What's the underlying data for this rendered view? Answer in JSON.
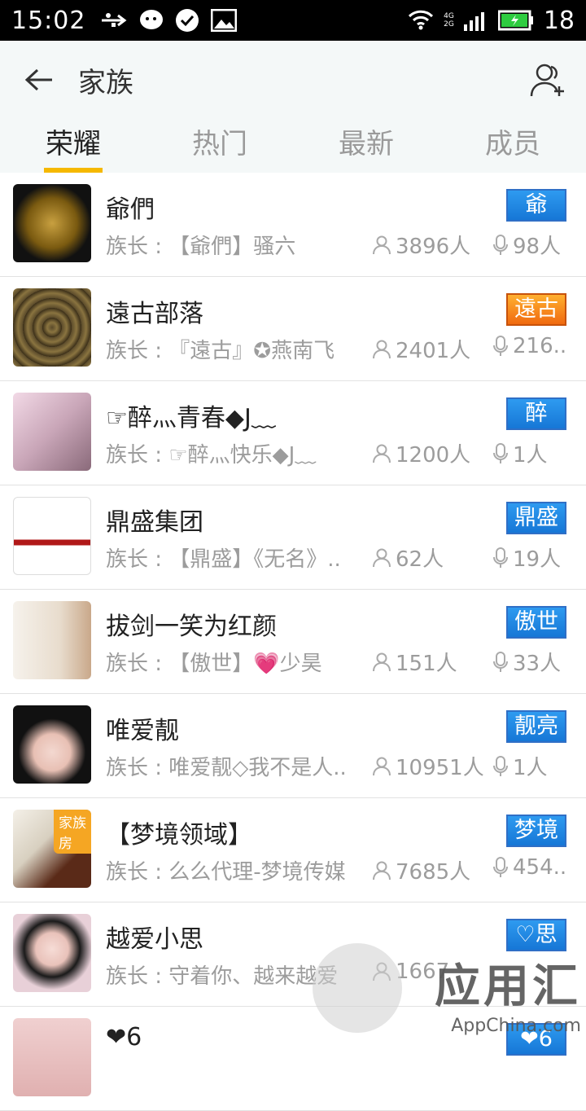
{
  "status_bar": {
    "time": "15:02",
    "battery_level": "18",
    "icons": [
      "usb-icon",
      "wechat-icon",
      "check-circle-icon",
      "image-icon",
      "wifi-icon",
      "signal-4g-icon",
      "battery-icon"
    ],
    "network_4g": "4G",
    "network_2g": "2G"
  },
  "header": {
    "title": "家族",
    "back_icon": "arrow-left-icon",
    "add_icon": "add-member-icon"
  },
  "tabs": [
    {
      "label": "荣耀",
      "active": true
    },
    {
      "label": "热门",
      "active": false
    },
    {
      "label": "最新",
      "active": false
    },
    {
      "label": "成员",
      "active": false
    }
  ],
  "families": [
    {
      "name": "爺們",
      "leader": "族长 : 【爺們】骚六",
      "members": "3896人",
      "voice": "98人",
      "badge": "爺",
      "badge_style": "blue"
    },
    {
      "name": "遠古部落",
      "leader": "族长 : 『遠古』✪燕南飞",
      "members": "2401人",
      "voice": "216..",
      "badge": "遠古",
      "badge_style": "orange"
    },
    {
      "name": "☞醉灬青春◆J﹏",
      "leader": "族长 : ☞醉灬快乐◆J﹏",
      "members": "1200人",
      "voice": "1人",
      "badge": "醉",
      "badge_style": "blue"
    },
    {
      "name": "鼎盛集团",
      "leader": "族长 : 【鼎盛】《无名》..",
      "members": "62人",
      "voice": "19人",
      "badge": "鼎盛",
      "badge_style": "blue"
    },
    {
      "name": "拔剑一笑为红颜",
      "leader": "族长 : 【傲世】💗少昊",
      "members": "151人",
      "voice": "33人",
      "badge": "傲世",
      "badge_style": "blue"
    },
    {
      "name": "唯爱靓",
      "leader": "族长 : 唯爱靓◇我不是人..",
      "members": "10951人",
      "voice": "1人",
      "badge": "靓亮",
      "badge_style": "blue"
    },
    {
      "name": "【梦境领域】",
      "leader": "族长 : 么么代理-梦境传媒",
      "members": "7685人",
      "voice": "454..",
      "badge": "梦境",
      "badge_style": "blue",
      "room_tag": "家族房"
    },
    {
      "name": "越爱小思",
      "leader": "族长 : 守着你、越来越爱",
      "members": "1667",
      "voice": "",
      "badge": "♡思",
      "badge_style": "blue"
    },
    {
      "name": "❤6",
      "leader": "",
      "members": "",
      "voice": "",
      "badge": "❤6",
      "badge_style": "blue"
    }
  ],
  "watermark": {
    "main": "应用汇",
    "sub": "AppChina.com"
  },
  "colors": {
    "accent": "#f5b800",
    "badge_blue": "#1e86e0",
    "badge_orange": "#f07a15",
    "header_bg": "#f4f8f8"
  }
}
